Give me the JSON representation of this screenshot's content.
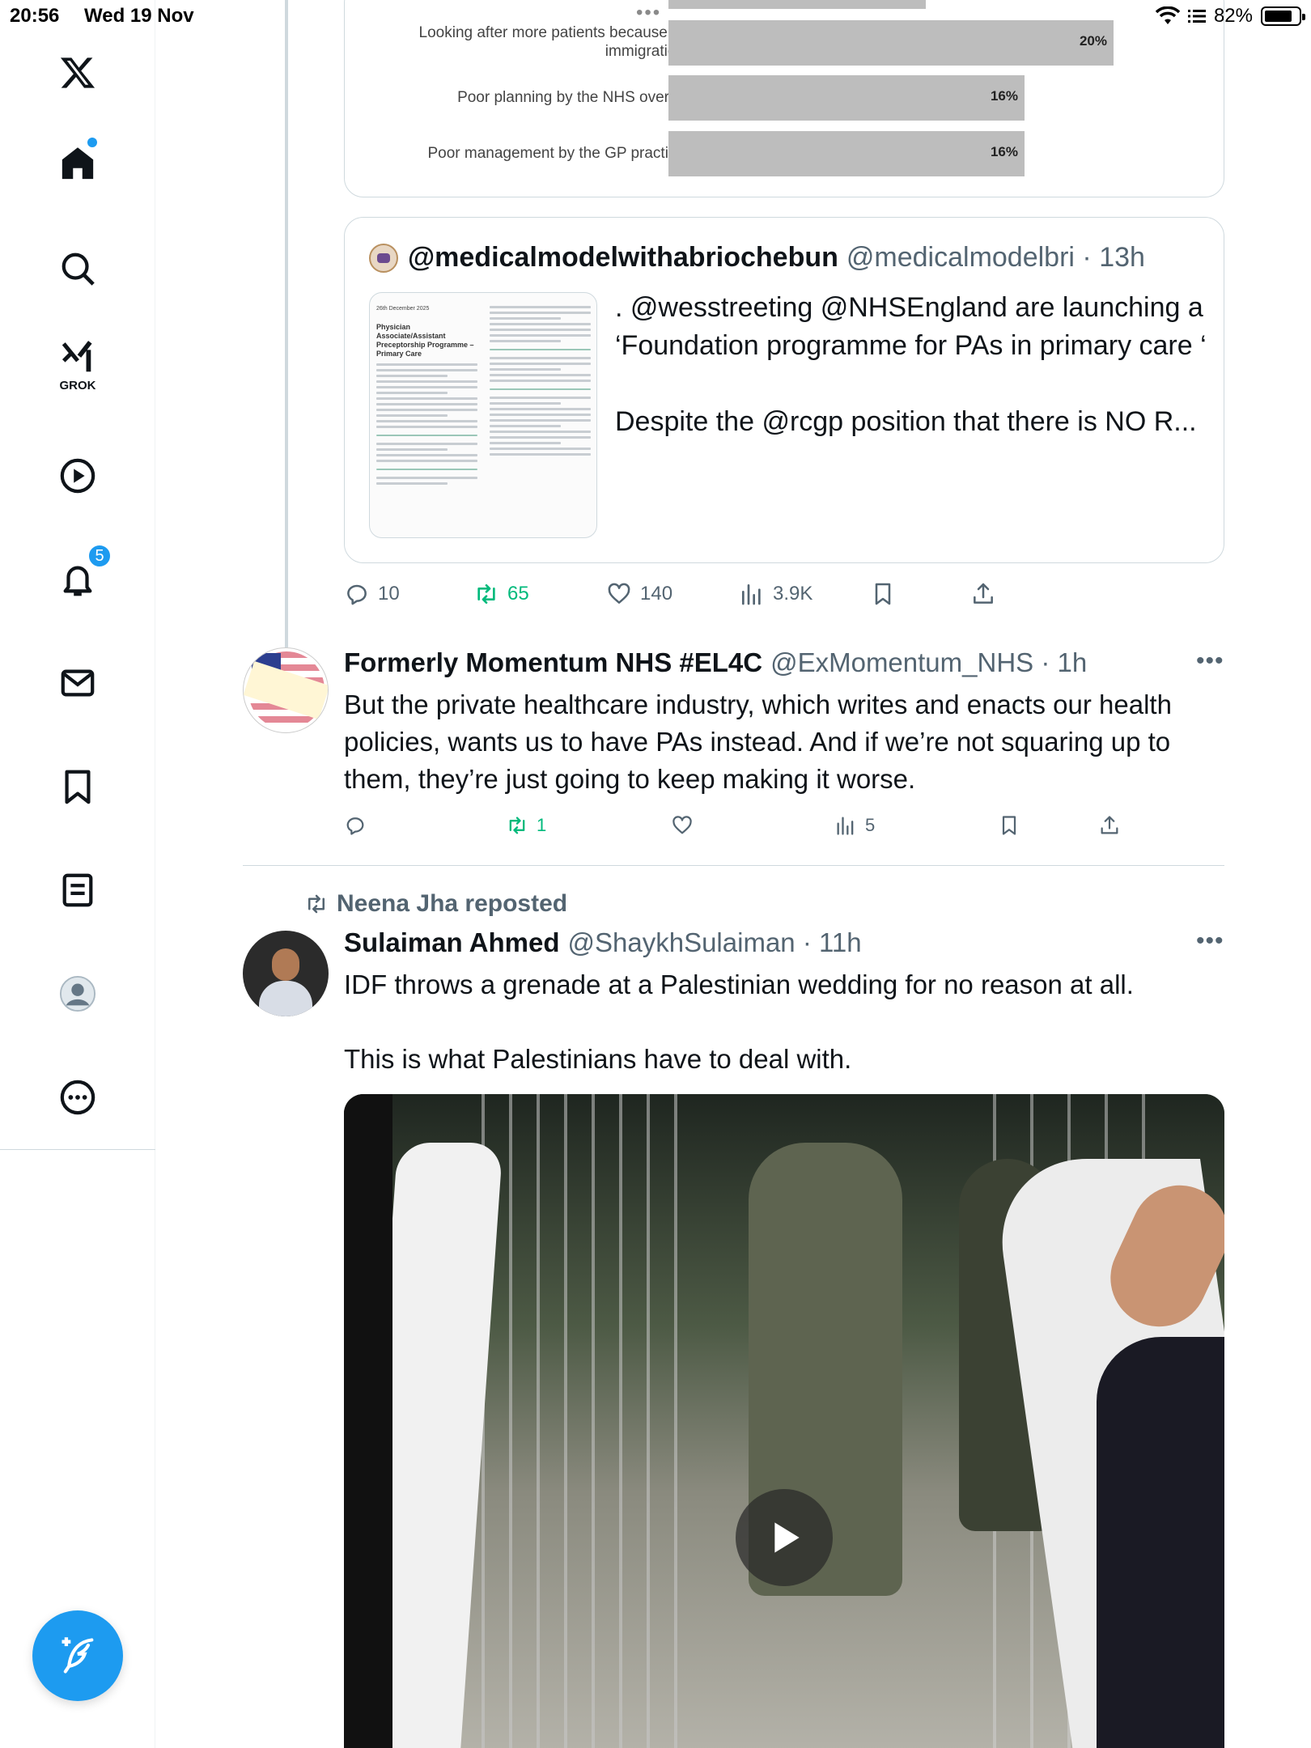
{
  "status_bar": {
    "time": "20:56",
    "date": "Wed 19 Nov",
    "battery_text": "82%",
    "battery_level": 0.82
  },
  "sidebar": {
    "items": [
      {
        "name": "x-logo",
        "label": ""
      },
      {
        "name": "home",
        "label": ""
      },
      {
        "name": "explore",
        "label": ""
      },
      {
        "name": "grok",
        "label": "GROK"
      },
      {
        "name": "video",
        "label": ""
      },
      {
        "name": "notifications",
        "label": "",
        "badge": "5"
      },
      {
        "name": "messages",
        "label": ""
      },
      {
        "name": "bookmarks",
        "label": ""
      },
      {
        "name": "lists",
        "label": ""
      },
      {
        "name": "profile",
        "label": ""
      },
      {
        "name": "more",
        "label": ""
      }
    ],
    "accent": "#1d9bf0"
  },
  "chart_data": {
    "type": "bar",
    "orientation": "horizontal",
    "categories": [
      "Looking after more patients because of immigration",
      "Poor planning by the NHS overall",
      "Poor management by the GP practice"
    ],
    "values": [
      20,
      16,
      16
    ],
    "value_labels": [
      "20%",
      "16%",
      "16%"
    ],
    "bar_color": "#bdbdbd",
    "xlim": [
      0,
      40
    ]
  },
  "quote": {
    "display_name": "@medicalmodelwithabriochebun",
    "handle": "@medicalmodelbri",
    "time": "13h",
    "text": ". @wesstreeting @NHSEngland are launching a ‘Foundation programme for PAs in primary care ‘\n\nDespite the @rcgp position that there is NO R...",
    "doc_title": "Physician Associate/Assistant Preceptorship Programme – Primary Care",
    "doc_date": "26th December 2025"
  },
  "quote_actions": {
    "replies": "10",
    "reposts": "65",
    "likes": "140",
    "views": "3.9K"
  },
  "tweet1": {
    "display_name": "Formerly Momentum NHS #EL4C",
    "handle": "@ExMomentum_NHS",
    "time": "1h",
    "text": "But the private healthcare industry, which writes and enacts our health policies, wants us to have PAs instead. And if we’re not squaring up to them, they’re just going to keep making it worse.",
    "actions": {
      "replies": "",
      "reposts": "1",
      "likes": "",
      "views": "5"
    }
  },
  "tweet2": {
    "repost_by": "Neena Jha reposted",
    "display_name": "Sulaiman Ahmed",
    "handle": "@ShaykhSulaiman",
    "time": "11h",
    "text": "IDF throws a grenade at a Palestinian wedding for no reason at all.\n\nThis is what Palestinians have to deal with."
  },
  "colors": {
    "accent": "#1d9bf0",
    "repost_green": "#00ba7c",
    "secondary_text": "#536471",
    "border": "#cfd9de"
  }
}
